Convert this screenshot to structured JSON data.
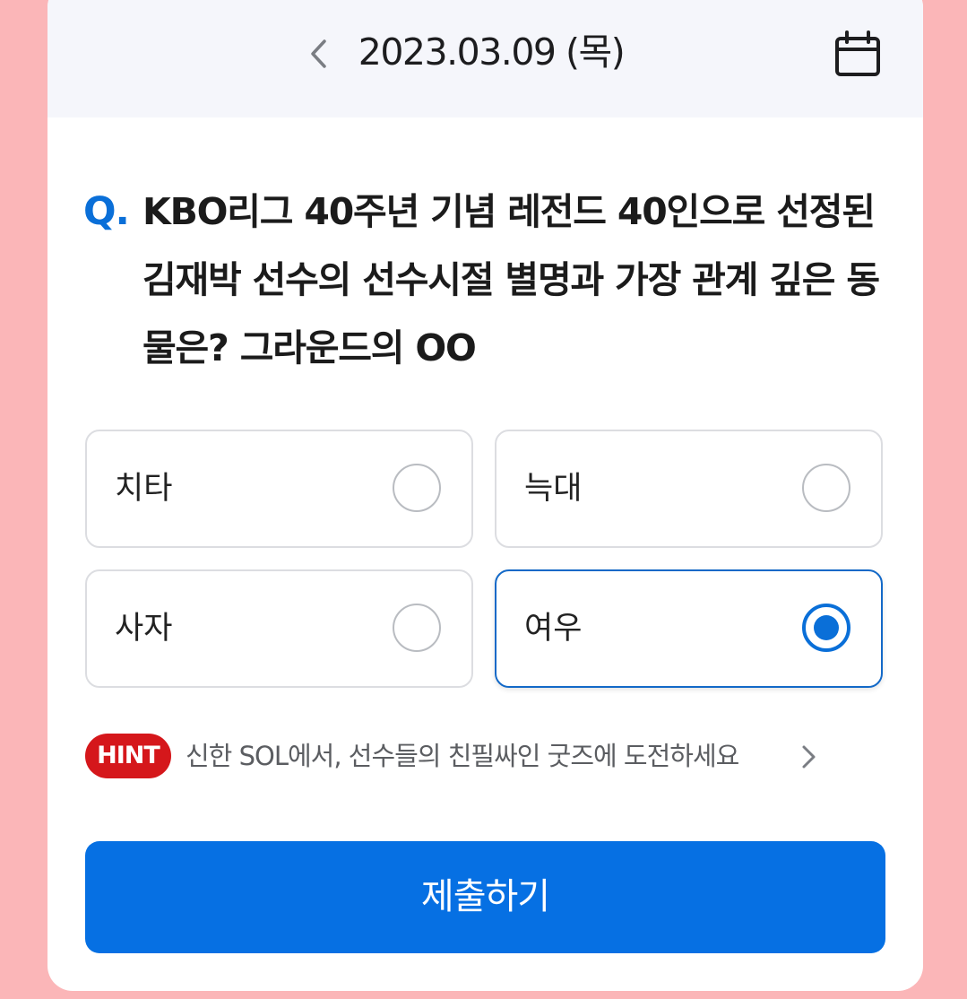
{
  "header": {
    "date": "2023.03.09 (목)",
    "prev_icon": "chevron-left-icon",
    "calendar_icon": "calendar-icon"
  },
  "question": {
    "prefix": "Q.",
    "text": "KBO리그 40주년 기념 레전드 40인으로 선정된 김재박 선수의 선수시절 별명과 가장 관계 깊은 동물은? 그라운드의 OO"
  },
  "options": [
    {
      "label": "치타",
      "selected": false
    },
    {
      "label": "늑대",
      "selected": false
    },
    {
      "label": "사자",
      "selected": false
    },
    {
      "label": "여우",
      "selected": true
    }
  ],
  "hint": {
    "badge": "HINT",
    "text": "신한 SOL에서, 선수들의 친필싸인 굿즈에 도전하세요"
  },
  "submit_label": "제출하기",
  "colors": {
    "background": "#fbb6b8",
    "accent": "#0670e3",
    "hint_badge": "#d5171b"
  }
}
